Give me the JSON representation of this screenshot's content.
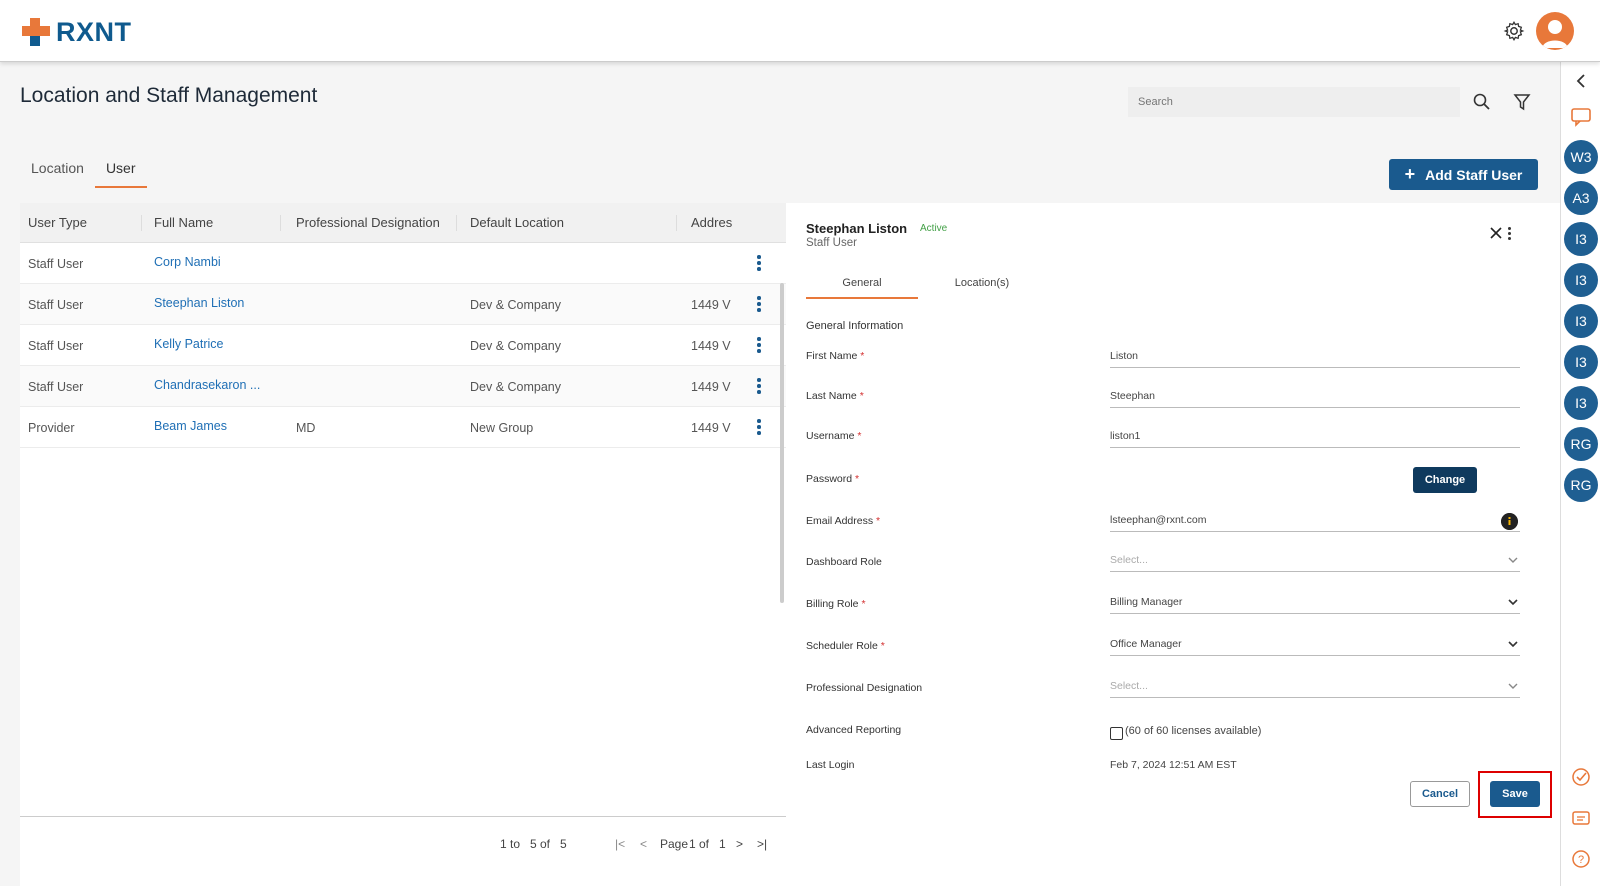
{
  "brand": {
    "name": "RXNT",
    "accent": "#e8783a",
    "primary": "#1a5a8e"
  },
  "header": {
    "icons": [
      "gear-icon",
      "user-avatar"
    ]
  },
  "page": {
    "title": "Location and Staff Management",
    "search_placeholder": "Search",
    "add_button": "Add Staff User"
  },
  "tabs": [
    {
      "label": "Location",
      "active": false
    },
    {
      "label": "User",
      "active": true
    }
  ],
  "table": {
    "columns": [
      "User Type",
      "Full Name",
      "Professional Designation",
      "Default Location",
      "Addres"
    ],
    "rows": [
      {
        "type": "Staff User",
        "name": "Corp Nambi",
        "designation": "",
        "location": "",
        "address": ""
      },
      {
        "type": "Staff User",
        "name": "Steephan Liston",
        "designation": "",
        "location": "Dev & Company",
        "address": "1449 V"
      },
      {
        "type": "Staff User",
        "name": "Kelly Patrice",
        "designation": "",
        "location": "Dev & Company",
        "address": "1449 V"
      },
      {
        "type": "Staff User",
        "name": "Chandrasekaron ...",
        "designation": "",
        "location": "Dev & Company",
        "address": "1449 V"
      },
      {
        "type": "Provider",
        "name": "Beam James",
        "designation": "MD",
        "location": "New Group",
        "address": "1449 V"
      }
    ],
    "pager": {
      "from": "1",
      "to_label": "to",
      "to": "5",
      "of_label": "of",
      "total": "5",
      "page_label": "Page",
      "page": "1",
      "page_of_label": "of",
      "pages": "1"
    }
  },
  "detail": {
    "name": "Steephan Liston",
    "status": "Active",
    "user_type": "Staff User",
    "tabs": [
      "General",
      "Location(s)"
    ],
    "section_title": "General Information",
    "fields": {
      "first_name": {
        "label": "First Name",
        "value": "Liston"
      },
      "last_name": {
        "label": "Last Name",
        "value": "Steephan"
      },
      "username": {
        "label": "Username",
        "value": "liston1"
      },
      "password": {
        "label": "Password",
        "button": "Change"
      },
      "email": {
        "label": "Email Address",
        "value": "lsteephan@rxnt.com"
      },
      "dashboard_role": {
        "label": "Dashboard Role",
        "placeholder": "Select..."
      },
      "billing_role": {
        "label": "Billing Role",
        "value": "Billing Manager"
      },
      "scheduler_role": {
        "label": "Scheduler Role",
        "value": "Office Manager"
      },
      "professional_designation": {
        "label": "Professional Designation",
        "placeholder": "Select..."
      },
      "advanced_reporting": {
        "label": "Advanced Reporting",
        "text": "(60 of 60 licenses available)"
      },
      "last_login": {
        "label": "Last Login",
        "value": "Feb 7, 2024 12:51 AM EST"
      }
    },
    "cancel": "Cancel",
    "save": "Save"
  },
  "rail": {
    "avatars": [
      "W3",
      "A3",
      "I3",
      "I3",
      "I3",
      "I3",
      "I3",
      "RG",
      "RG"
    ]
  }
}
